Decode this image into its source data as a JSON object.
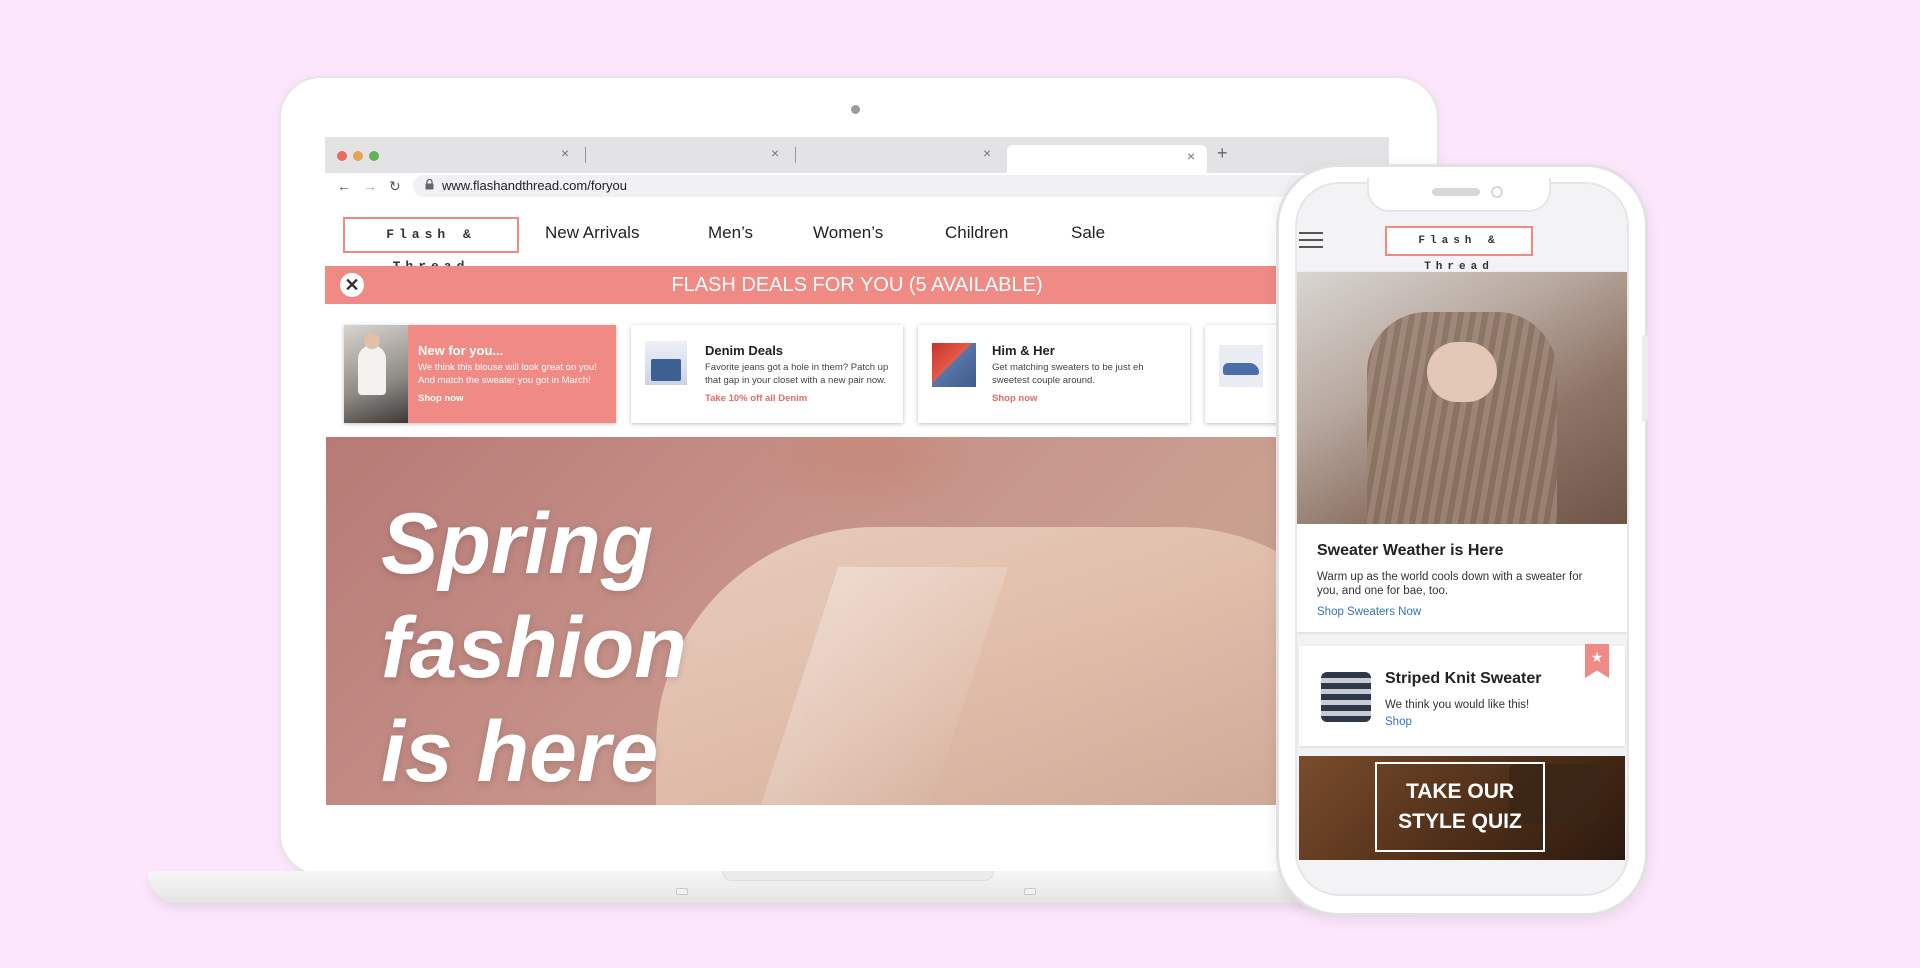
{
  "browser": {
    "url": "www.flashandthread.com/foryou",
    "new_tab_glyph": "+",
    "close_glyph": "×",
    "nav": {
      "back": "←",
      "forward": "→",
      "reload": "↻"
    }
  },
  "site": {
    "logo": "Flash & Thread",
    "nav": [
      "New Arrivals",
      "Men’s",
      "Women’s",
      "Children",
      "Sale"
    ],
    "banner": {
      "title": "FLASH DEALS FOR YOU (5 AVAILABLE)",
      "close_glyph": "✕"
    },
    "deals": [
      {
        "title": "New for you...",
        "desc": "We think this blouse will look great on you! And match the sweater you got in March!",
        "link": "Shop now"
      },
      {
        "title": "Denim Deals",
        "desc": "Favorite jeans got a hole in them? Patch up that gap in your closet with a new pair now.",
        "link": "Take 10% off all Denim"
      },
      {
        "title": "Him & Her",
        "desc": "Get matching sweaters to be just eh sweetest couple around.",
        "link": "Shop now"
      }
    ],
    "hero": {
      "line1": "Spring",
      "line2": "fashion",
      "line3": "is here"
    }
  },
  "mobile": {
    "logo": "Flash & Thread",
    "feature": {
      "title": "Sweater Weather is Here",
      "desc": "Warm up as the world cools down with a sweater for you, and one for bae, too.",
      "link": "Shop Sweaters Now"
    },
    "recommendation": {
      "title": "Striped Knit Sweater",
      "desc": "We think you would like this!",
      "link": "Shop",
      "ribbon_glyph": "★"
    },
    "quiz": {
      "line1": "TAKE OUR",
      "line2": "STYLE QUIZ"
    }
  },
  "colors": {
    "accent": "#ef8a84",
    "link": "#3673b8",
    "background": "#fce6fb"
  }
}
